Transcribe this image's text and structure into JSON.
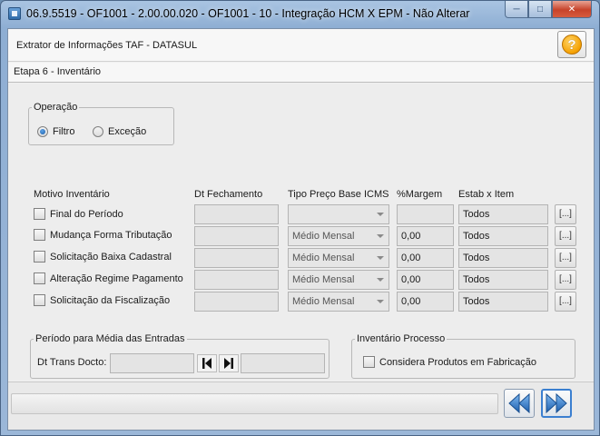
{
  "window": {
    "title": "06.9.5519 - OF1001 - 2.00.00.020 - OF1001 - 10 - Integração HCM X EPM - Não Alterar"
  },
  "header": {
    "title": "Extrator de Informações TAF - DATASUL",
    "help_label": "?"
  },
  "step": {
    "title": "Etapa 6 - Inventário"
  },
  "operacao": {
    "legend": "Operação",
    "options": [
      {
        "label": "Filtro",
        "selected": true
      },
      {
        "label": "Exceção",
        "selected": false
      }
    ]
  },
  "inventory": {
    "headers": {
      "motivo": "Motivo Inventário",
      "dt_fechamento": "Dt Fechamento",
      "tipo_preco": "Tipo Preço Base ICMS",
      "margem": "%Margem",
      "estab": "Estab x Item"
    },
    "rows": [
      {
        "label": "Final do Período",
        "dt": "",
        "tipo": "",
        "margem": "",
        "estab": "Todos",
        "button": "[...]"
      },
      {
        "label": "Mudança Forma Tributação",
        "dt": "",
        "tipo": "Médio Mensal",
        "margem": "0,00",
        "estab": "Todos",
        "button": "[...]"
      },
      {
        "label": "Solicitação Baixa Cadastral",
        "dt": "",
        "tipo": "Médio Mensal",
        "margem": "0,00",
        "estab": "Todos",
        "button": "[...]"
      },
      {
        "label": "Alteração Regime Pagamento",
        "dt": "",
        "tipo": "Médio Mensal",
        "margem": "0,00",
        "estab": "Todos",
        "button": "[...]"
      },
      {
        "label": "Solicitação da Fiscalização",
        "dt": "",
        "tipo": "Médio Mensal",
        "margem": "0,00",
        "estab": "Todos",
        "button": "[...]"
      }
    ]
  },
  "periodo": {
    "legend": "Período para Média das Entradas",
    "field_label": "Dt Trans Docto:",
    "start_value": "",
    "end_value": "",
    "first_icon": "skip-back-icon",
    "last_icon": "skip-forward-icon"
  },
  "processo": {
    "legend": "Inventário Processo",
    "checkbox_label": "Considera Produtos em Fabricação"
  },
  "footer": {
    "back_icon": "double-chevron-left-icon",
    "next_icon": "double-chevron-right-icon"
  }
}
